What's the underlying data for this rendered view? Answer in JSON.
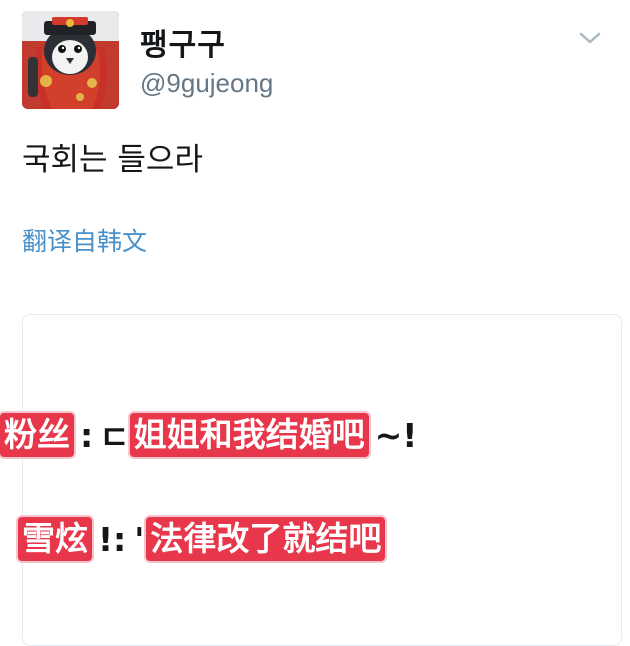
{
  "tweet": {
    "display_name": "팽구구",
    "handle": "@9gujeong",
    "text": "국회는 들으라",
    "translate_label": "翻译自韩文"
  },
  "image_caption": {
    "line1": {
      "speaker": "粉丝",
      "separator": ":",
      "fragment": "ㄷ",
      "text": "姐姐和我结婚吧",
      "tail": "~!"
    },
    "line2": {
      "speaker": "雪炫",
      "separator": "!:",
      "fragment": "'",
      "text": "法律改了就结吧"
    }
  },
  "colors": {
    "caption_highlight": "#e8364a",
    "link": "#4a90c8",
    "handle": "#657786"
  },
  "icons": {
    "menu": "chevron-down-icon",
    "avatar": "penguin-avatar"
  }
}
